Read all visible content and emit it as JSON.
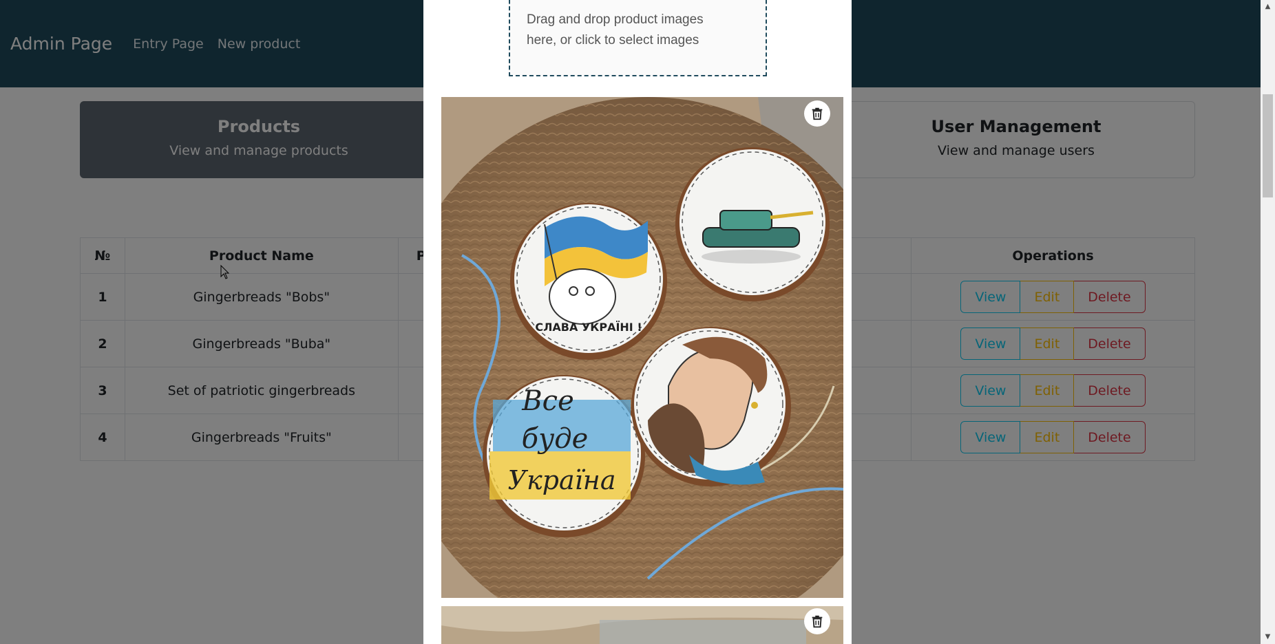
{
  "navbar": {
    "brand": "Admin Page",
    "links": [
      "Entry Page",
      "New product"
    ]
  },
  "cards": [
    {
      "title": "Products",
      "subtitle": "View and manage products"
    },
    {
      "title": "User Management",
      "subtitle": "View and manage users"
    }
  ],
  "table": {
    "headers": [
      "№",
      "Product Name",
      "P",
      "Operations"
    ],
    "rows": [
      {
        "num": "1",
        "name": "Gingerbreads \"Bobs\""
      },
      {
        "num": "2",
        "name": "Gingerbreads \"Buba\""
      },
      {
        "num": "3",
        "name": "Set of patriotic gingerbreads"
      },
      {
        "num": "4",
        "name": "Gingerbreads \"Fruits\""
      }
    ],
    "buttons": {
      "view": "View",
      "edit": "Edit",
      "delete": "Delete"
    }
  },
  "modal": {
    "dropzone_line1": "Drag and drop product images",
    "dropzone_line2": "here, or click to select images",
    "cookie_texts": {
      "slava": "СЛАВА УКРАЇНІ !",
      "vse": "Все",
      "bude": "буде",
      "ukraina": "Україна"
    }
  },
  "colors": {
    "navbar": "#1e4a5c",
    "active_card": "#5c6670",
    "view": "#0dcaf0",
    "edit": "#ffc107",
    "delete": "#dc3545"
  }
}
